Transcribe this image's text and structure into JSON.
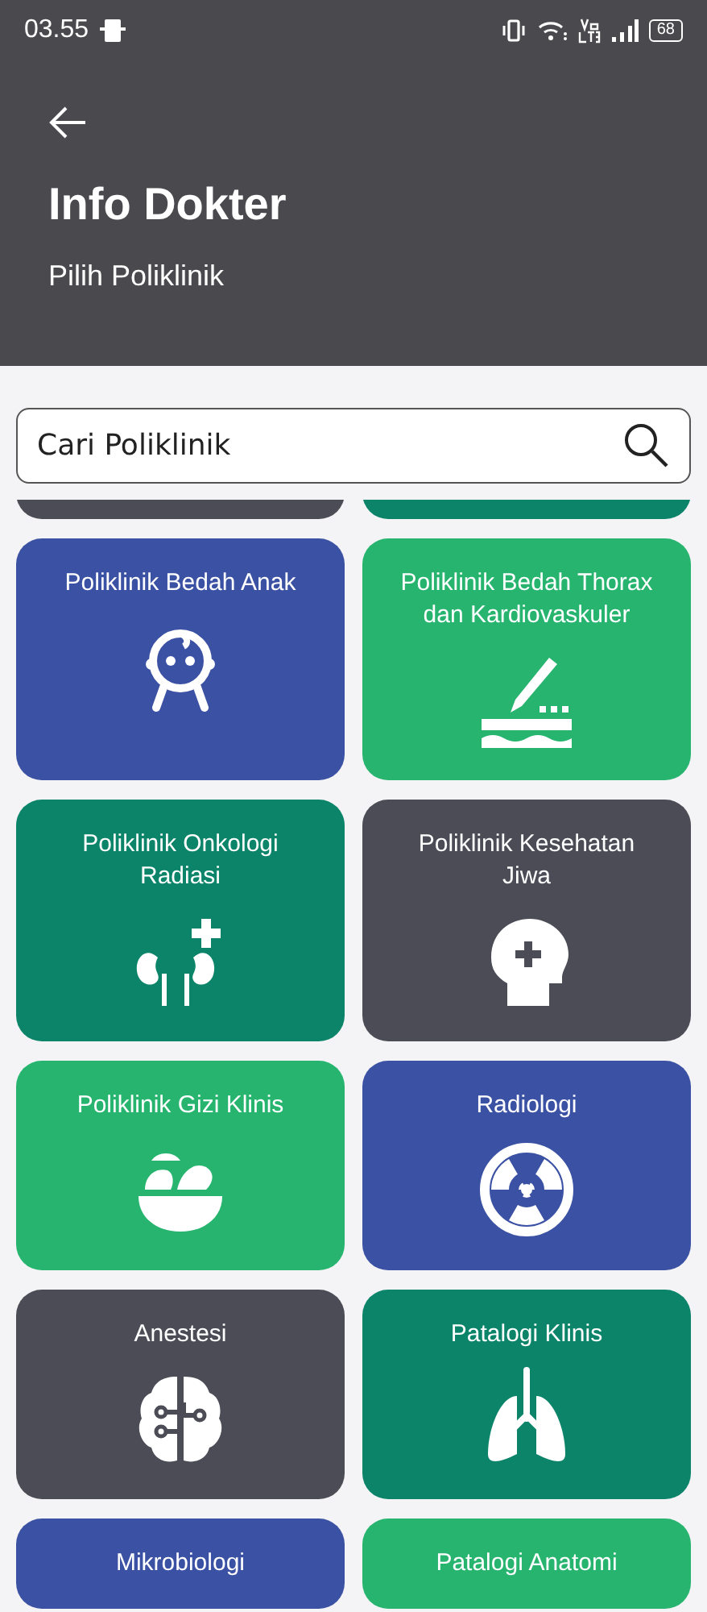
{
  "status_bar": {
    "time": "03.55",
    "battery": "68"
  },
  "header": {
    "title": "Info Dokter",
    "subtitle": "Pilih Poliklinik"
  },
  "search": {
    "placeholder": "Cari Poliklinik"
  },
  "cards": [
    {
      "color": "#4b4c55"
    },
    {
      "color": "#0b8469"
    },
    {
      "label": "Poliklinik Bedah Anak",
      "color": "#3b51a3",
      "kind": "baby"
    },
    {
      "label": "Poliklinik Bedah Thorax dan Kardiovaskuler",
      "color": "#27b46f",
      "kind": "scalpel"
    },
    {
      "label": "Poliklinik Onkologi Radiasi",
      "color": "#0b8469",
      "kind": "kidney"
    },
    {
      "label": "Poliklinik Kesehatan Jiwa",
      "color": "#4b4c55",
      "kind": "head"
    },
    {
      "label": "Poliklinik Gizi Klinis",
      "color": "#27b46f",
      "kind": "bowl"
    },
    {
      "label": "Radiologi",
      "color": "#3b51a3",
      "kind": "radiation"
    },
    {
      "label": "Anestesi",
      "color": "#4b4c55",
      "kind": "brain"
    },
    {
      "label": "Patalogi Klinis",
      "color": "#0b8469",
      "kind": "lungs"
    },
    {
      "label": "Mikrobiologi",
      "color": "#3b51a3"
    },
    {
      "label": "Patalogi Anatomi",
      "color": "#27b46f"
    }
  ]
}
